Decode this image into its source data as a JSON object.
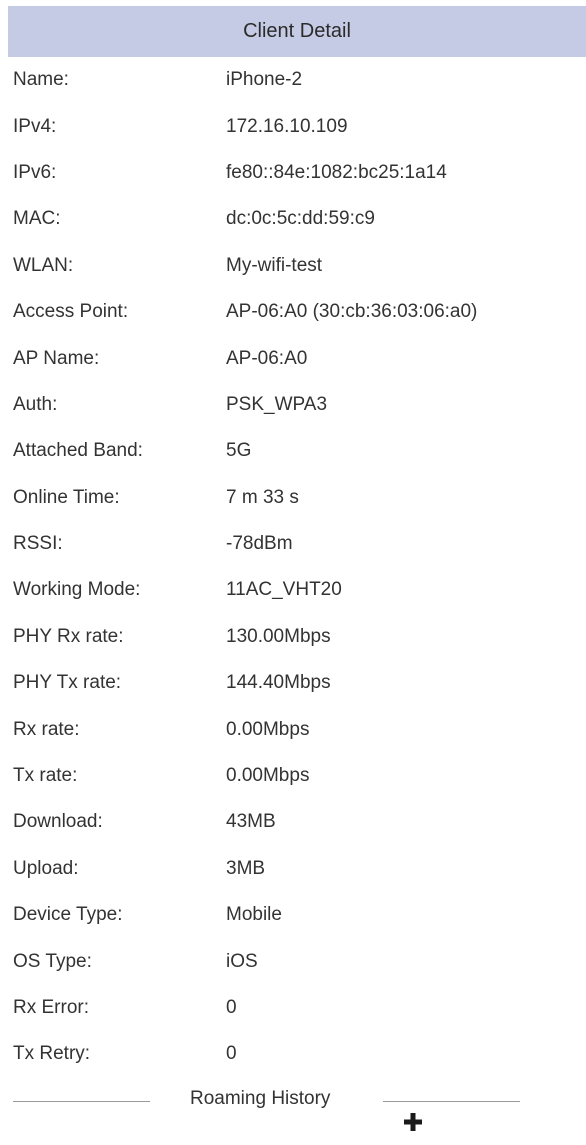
{
  "header": {
    "title": "Client Detail",
    "background": "#c5cbe4"
  },
  "details": [
    {
      "label": "Name:",
      "value": "iPhone-2"
    },
    {
      "label": "IPv4:",
      "value": "172.16.10.109"
    },
    {
      "label": "IPv6:",
      "value": "fe80::84e:1082:bc25:1a14"
    },
    {
      "label": "MAC:",
      "value": "dc:0c:5c:dd:59:c9"
    },
    {
      "label": "WLAN:",
      "value": "My-wifi-test"
    },
    {
      "label": "Access Point:",
      "value": "AP-06:A0 (30:cb:36:03:06:a0)"
    },
    {
      "label": "AP Name:",
      "value": "AP-06:A0"
    },
    {
      "label": "Auth:",
      "value": "PSK_WPA3"
    },
    {
      "label": "Attached Band:",
      "value": "5G"
    },
    {
      "label": "Online Time:",
      "value": "7 m 33 s"
    },
    {
      "label": "RSSI:",
      "value": "-78dBm"
    },
    {
      "label": "Working Mode:",
      "value": "11AC_VHT20"
    },
    {
      "label": "PHY Rx rate:",
      "value": "130.00Mbps"
    },
    {
      "label": "PHY Tx rate:",
      "value": "144.40Mbps"
    },
    {
      "label": "Rx rate:",
      "value": "0.00Mbps"
    },
    {
      "label": "Tx rate:",
      "value": "0.00Mbps"
    },
    {
      "label": "Download:",
      "value": "43MB"
    },
    {
      "label": "Upload:",
      "value": "3MB"
    },
    {
      "label": "Device Type:",
      "value": "Mobile"
    },
    {
      "label": "OS Type:",
      "value": "iOS"
    },
    {
      "label": "Rx Error:",
      "value": "0"
    },
    {
      "label": "Tx Retry:",
      "value": "0"
    }
  ],
  "roaming": {
    "title": "Roaming History",
    "expand_icon": "plus-icon"
  }
}
